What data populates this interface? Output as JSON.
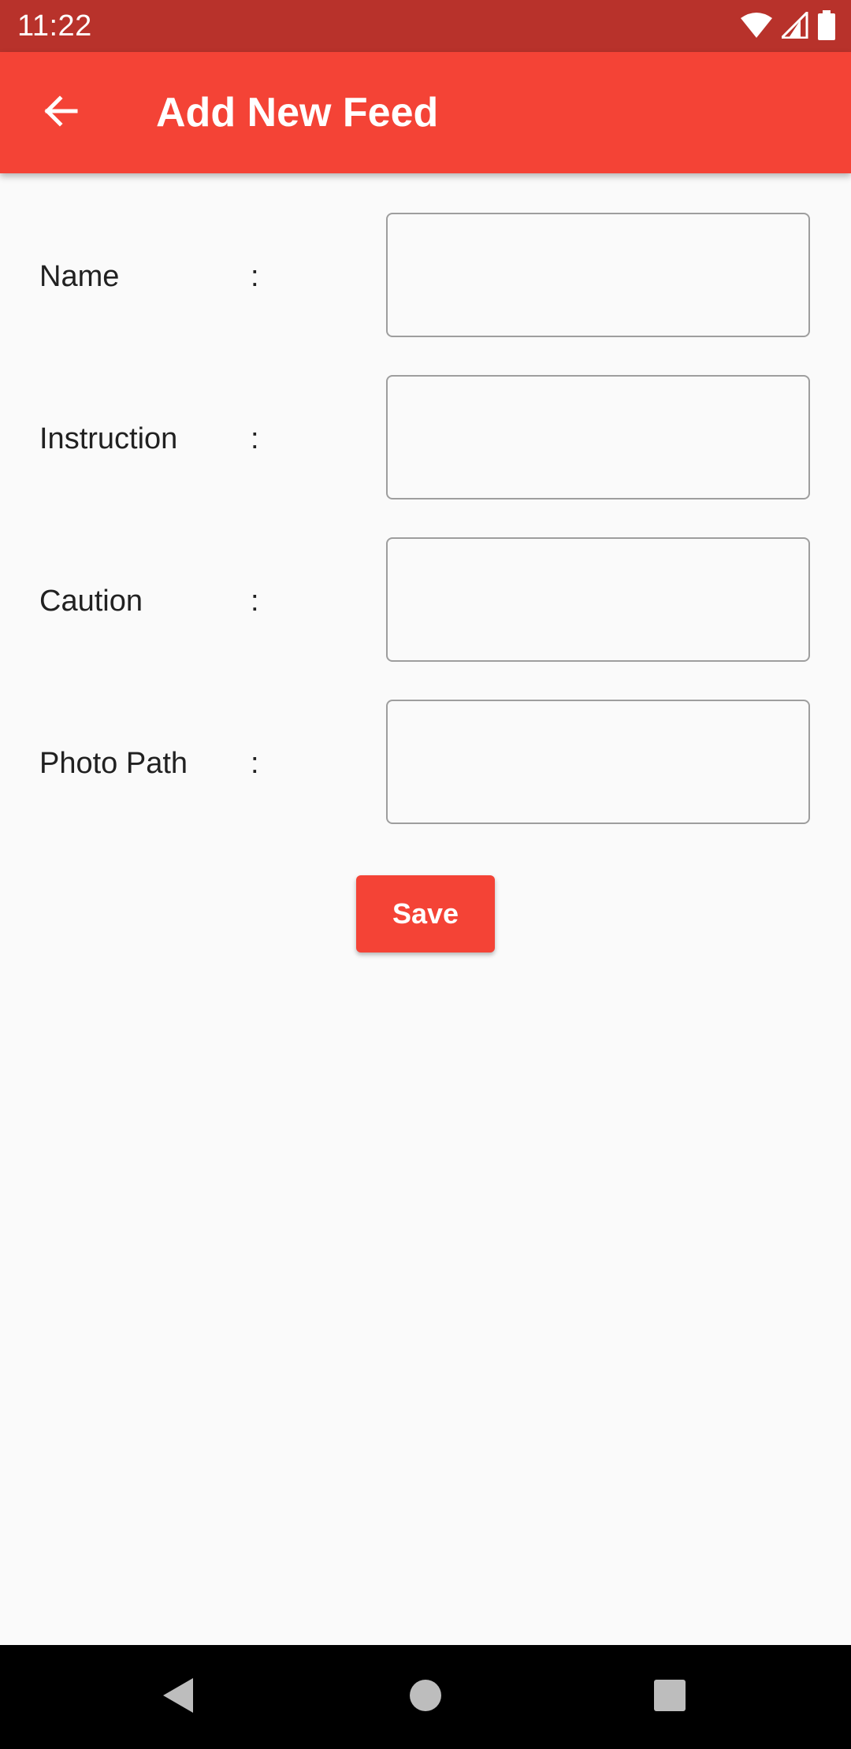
{
  "status_bar": {
    "time": "11:22",
    "icons": [
      "wifi-icon",
      "cell-signal-icon",
      "battery-icon"
    ]
  },
  "app_bar": {
    "title": "Add New Feed",
    "back_icon": "arrow-back-icon",
    "color": "#f44336"
  },
  "form": {
    "separator": ":",
    "fields": [
      {
        "label": "Name",
        "value": "",
        "placeholder": ""
      },
      {
        "label": "Instruction",
        "value": "",
        "placeholder": ""
      },
      {
        "label": "Caution",
        "value": "",
        "placeholder": ""
      },
      {
        "label": "Photo Path",
        "value": "",
        "placeholder": ""
      }
    ]
  },
  "actions": {
    "save_label": "Save"
  },
  "nav_bar": {
    "icons": [
      "back-triangle-icon",
      "home-circle-icon",
      "recents-square-icon"
    ]
  }
}
